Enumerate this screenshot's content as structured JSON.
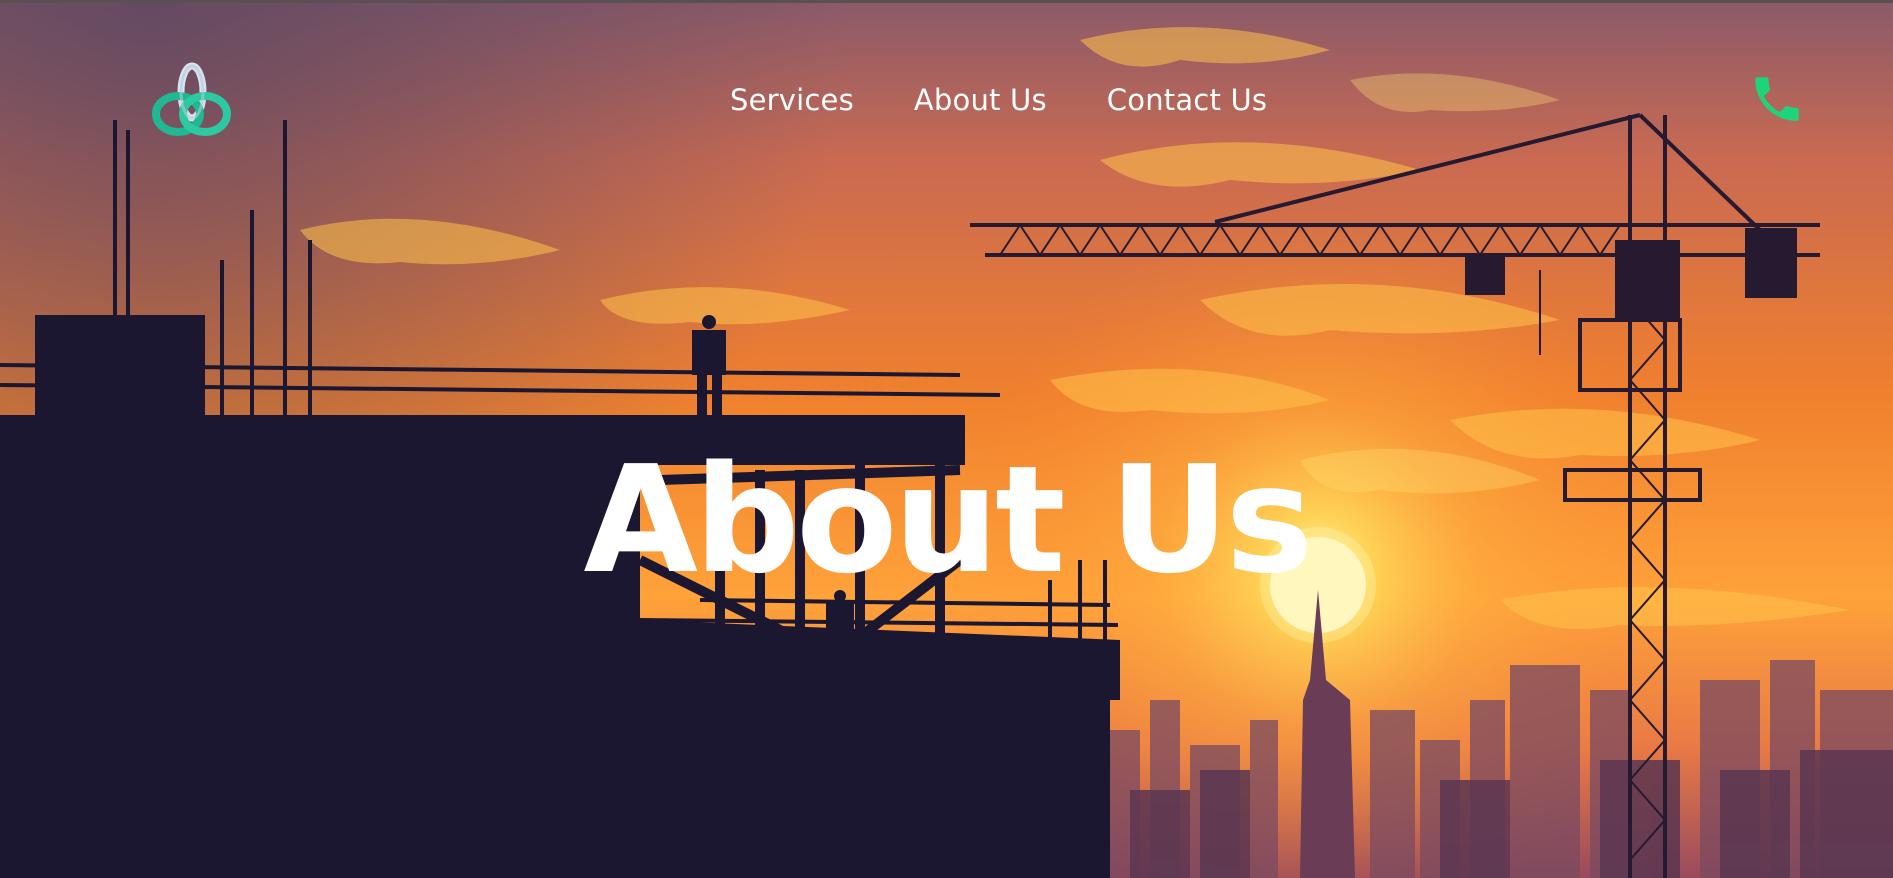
{
  "header": {
    "nav": [
      {
        "label": "Services"
      },
      {
        "label": "About Us"
      },
      {
        "label": "Contact Us"
      }
    ],
    "logo_icon": "interlocked-rings-logo",
    "phone_icon": "phone-icon"
  },
  "hero": {
    "title": "About Us",
    "background": "construction-site-sunset-silhouette"
  },
  "colors": {
    "accent_green": "#1fd37a",
    "sky_orange": "#f0802e",
    "silhouette": "#1b1730",
    "text": "#ffffff"
  }
}
